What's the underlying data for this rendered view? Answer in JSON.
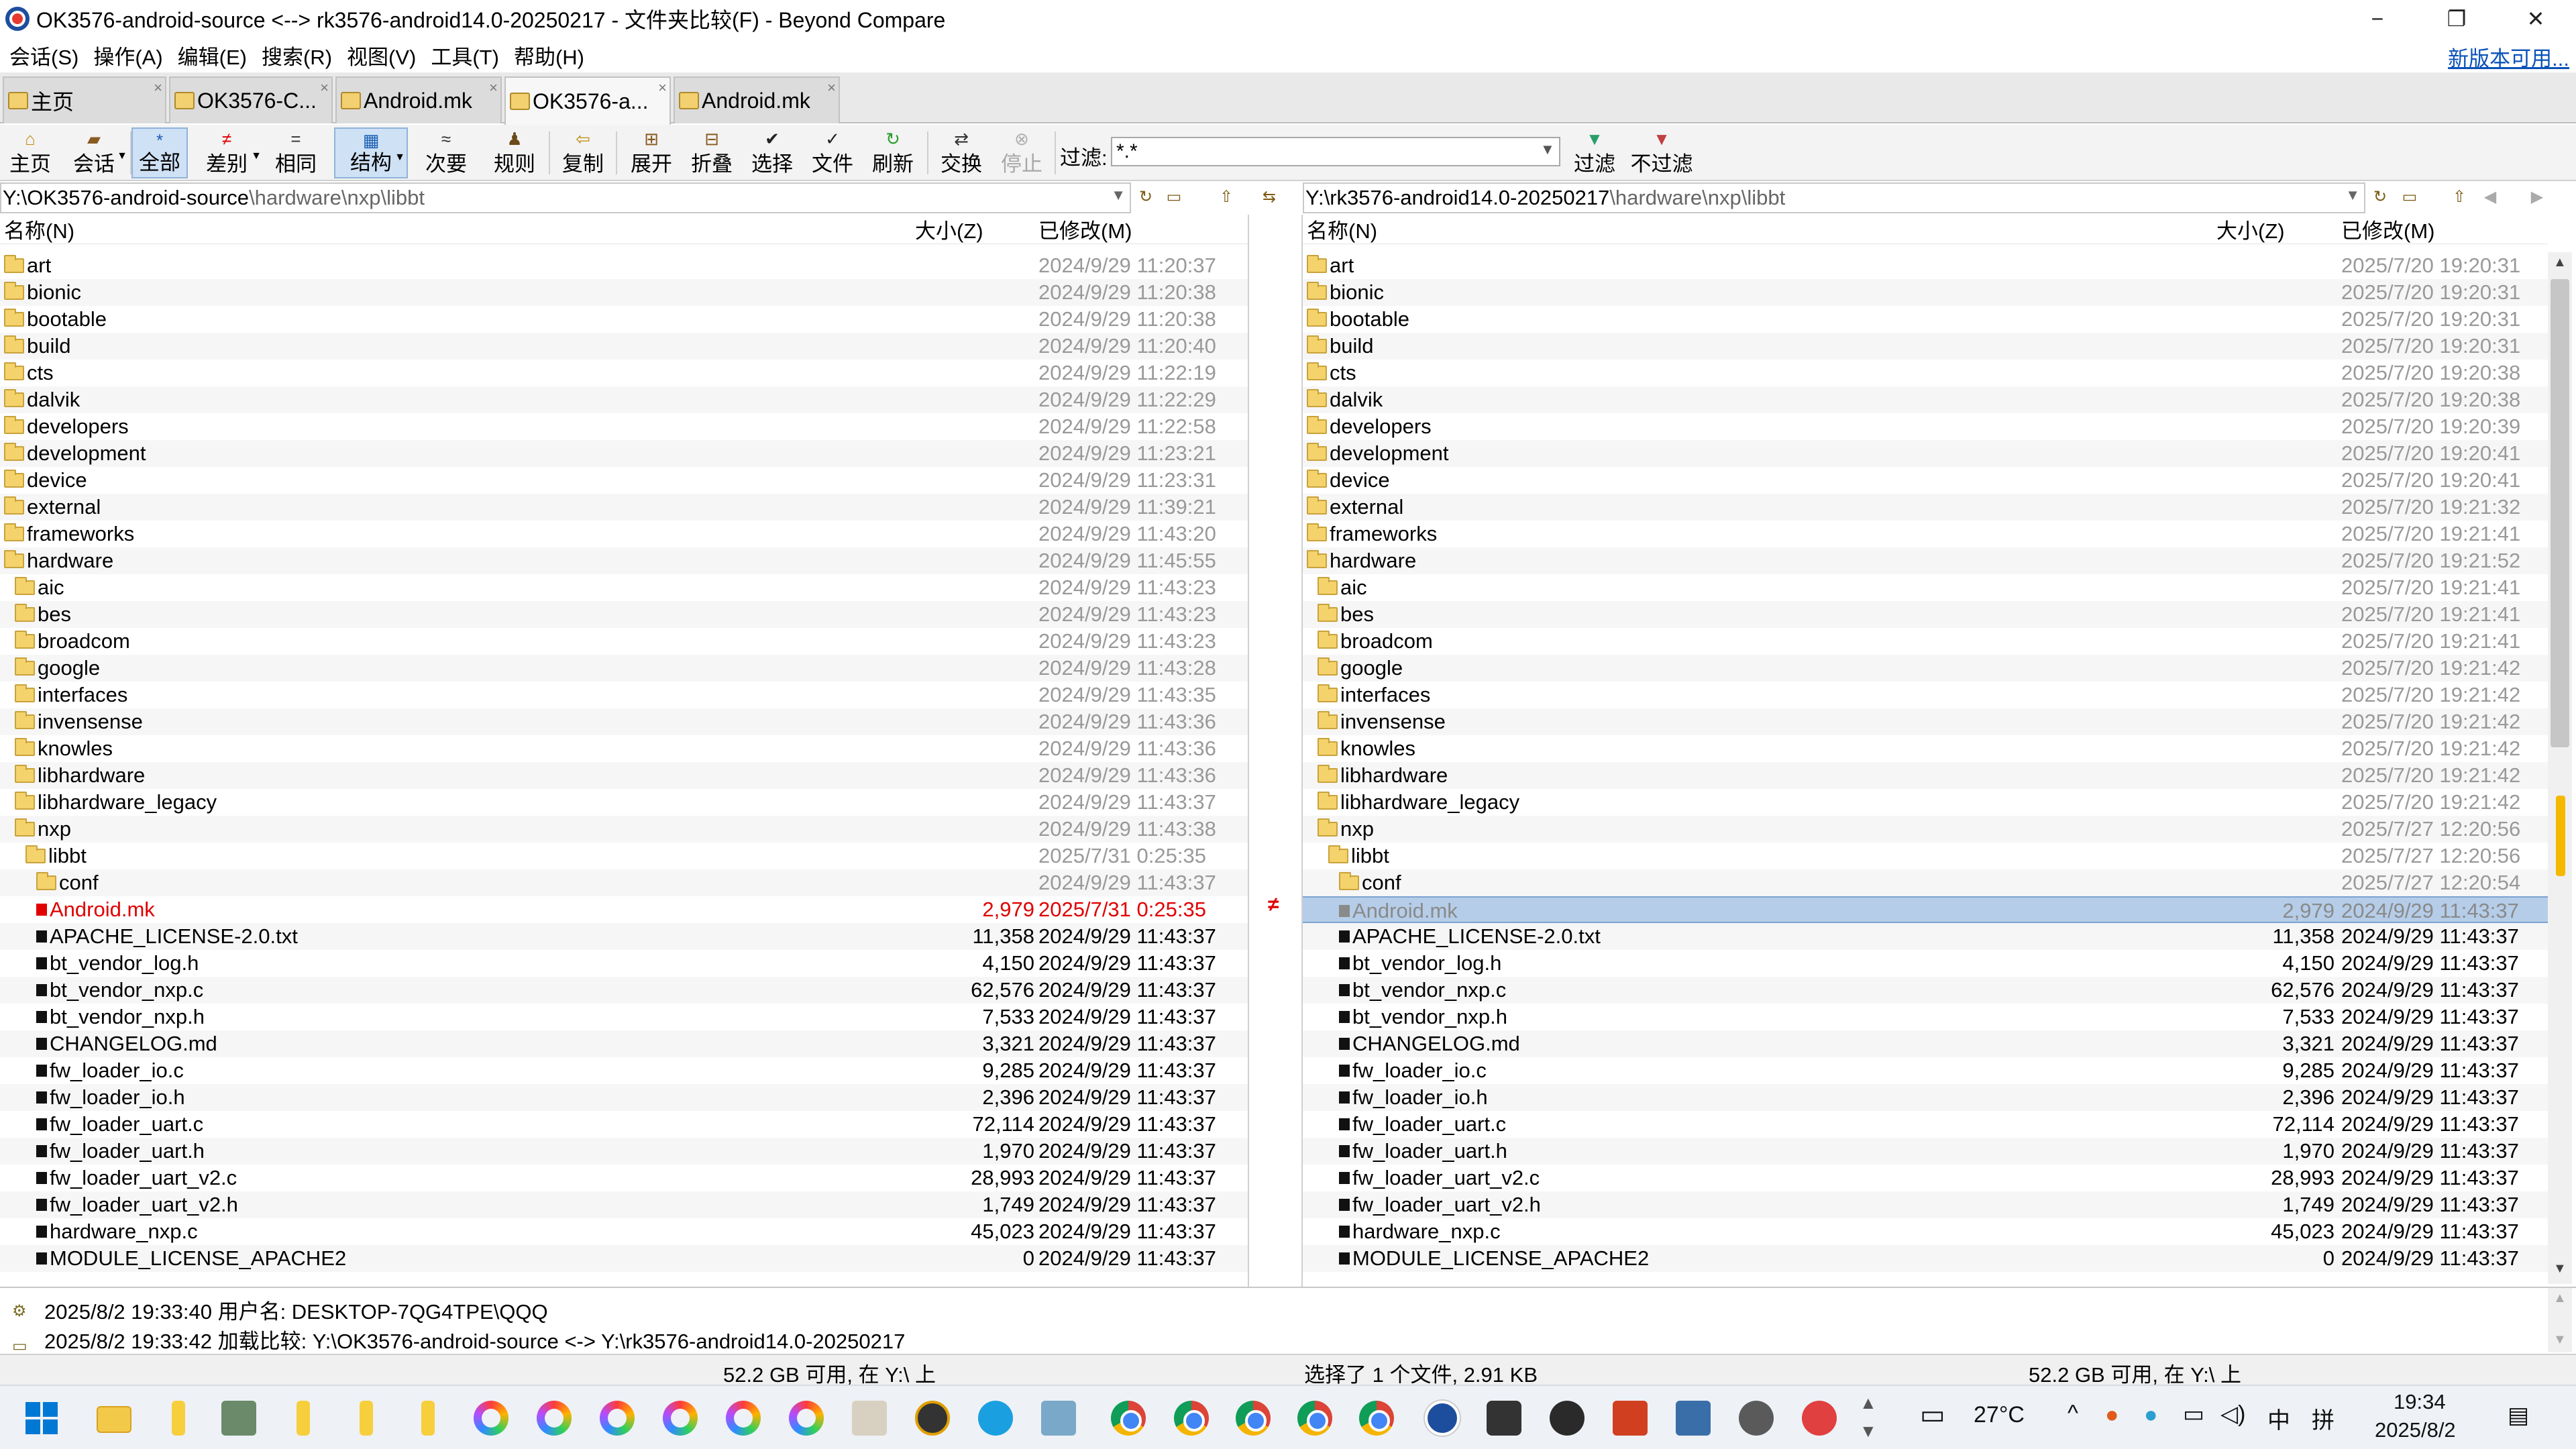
{
  "window": {
    "title": "OK3576-android-source <--> rk3576-android14.0-20250217 - 文件夹比较(F) - Beyond Compare",
    "minimize": "−",
    "maximize": "❐",
    "close": "✕"
  },
  "menu": [
    "会话(S)",
    "操作(A)",
    "编辑(E)",
    "搜索(R)",
    "视图(V)",
    "工具(T)",
    "帮助(H)"
  ],
  "update_link": "新版本可用...",
  "tabs": [
    "主页",
    "OK3576-C...",
    "Android.mk",
    "OK3576-a...",
    "Android.mk"
  ],
  "toolbar": {
    "home": "主页",
    "session": "会话",
    "all": "全部",
    "diff": "差别",
    "same": "相同",
    "structure": "结构",
    "minor": "次要",
    "rules": "规则",
    "copy": "复制",
    "expand": "展开",
    "collapse": "折叠",
    "select": "选择",
    "files": "文件",
    "refresh": "刷新",
    "swap": "交换",
    "stop": "停止",
    "filter_label": "过滤:",
    "filter_value": "*.*",
    "filter": "过滤",
    "no_filter": "不过滤"
  },
  "left": {
    "path_prefix": "Y:\\OK3576-android-source",
    "path_rest": "\\hardware\\nxp\\libbt",
    "col_name": "名称(N)",
    "col_size": "大小(Z)",
    "col_modified": "已修改(M)"
  },
  "right": {
    "path_prefix": "Y:\\rk3576-android14.0-20250217",
    "path_rest": "\\hardware\\nxp\\libbt",
    "col_name": "名称(N)",
    "col_size": "大小(Z)",
    "col_modified": "已修改(M)"
  },
  "center_mark": "≠",
  "left_rows": [
    {
      "name": "art",
      "type": "folder",
      "indent": 0,
      "size": "",
      "date": "2024/9/29 11:20:37"
    },
    {
      "name": "bionic",
      "type": "folder",
      "indent": 0,
      "size": "",
      "date": "2024/9/29 11:20:38"
    },
    {
      "name": "bootable",
      "type": "folder",
      "indent": 0,
      "size": "",
      "date": "2024/9/29 11:20:38"
    },
    {
      "name": "build",
      "type": "folder",
      "indent": 0,
      "size": "",
      "date": "2024/9/29 11:20:40"
    },
    {
      "name": "cts",
      "type": "folder",
      "indent": 0,
      "size": "",
      "date": "2024/9/29 11:22:19"
    },
    {
      "name": "dalvik",
      "type": "folder",
      "indent": 0,
      "size": "",
      "date": "2024/9/29 11:22:29"
    },
    {
      "name": "developers",
      "type": "folder",
      "indent": 0,
      "size": "",
      "date": "2024/9/29 11:22:58"
    },
    {
      "name": "development",
      "type": "folder",
      "indent": 0,
      "size": "",
      "date": "2024/9/29 11:23:21"
    },
    {
      "name": "device",
      "type": "folder",
      "indent": 0,
      "size": "",
      "date": "2024/9/29 11:23:31"
    },
    {
      "name": "external",
      "type": "folder",
      "indent": 0,
      "size": "",
      "date": "2024/9/29 11:39:21"
    },
    {
      "name": "frameworks",
      "type": "folder",
      "indent": 0,
      "size": "",
      "date": "2024/9/29 11:43:20"
    },
    {
      "name": "hardware",
      "type": "folder",
      "indent": 0,
      "size": "",
      "date": "2024/9/29 11:45:55"
    },
    {
      "name": "aic",
      "type": "folder",
      "indent": 1,
      "size": "",
      "date": "2024/9/29 11:43:23"
    },
    {
      "name": "bes",
      "type": "folder",
      "indent": 1,
      "size": "",
      "date": "2024/9/29 11:43:23"
    },
    {
      "name": "broadcom",
      "type": "folder",
      "indent": 1,
      "size": "",
      "date": "2024/9/29 11:43:23"
    },
    {
      "name": "google",
      "type": "folder",
      "indent": 1,
      "size": "",
      "date": "2024/9/29 11:43:28"
    },
    {
      "name": "interfaces",
      "type": "folder",
      "indent": 1,
      "size": "",
      "date": "2024/9/29 11:43:35"
    },
    {
      "name": "invensense",
      "type": "folder",
      "indent": 1,
      "size": "",
      "date": "2024/9/29 11:43:36"
    },
    {
      "name": "knowles",
      "type": "folder",
      "indent": 1,
      "size": "",
      "date": "2024/9/29 11:43:36"
    },
    {
      "name": "libhardware",
      "type": "folder",
      "indent": 1,
      "size": "",
      "date": "2024/9/29 11:43:36"
    },
    {
      "name": "libhardware_legacy",
      "type": "folder",
      "indent": 1,
      "size": "",
      "date": "2024/9/29 11:43:37"
    },
    {
      "name": "nxp",
      "type": "folder",
      "indent": 1,
      "size": "",
      "date": "2024/9/29 11:43:38"
    },
    {
      "name": "libbt",
      "type": "folder",
      "indent": 2,
      "size": "",
      "date": "2025/7/31 0:25:35"
    },
    {
      "name": "conf",
      "type": "folder",
      "indent": 3,
      "size": "",
      "date": "2024/9/29 11:43:37"
    },
    {
      "name": "Android.mk",
      "type": "file",
      "indent": 3,
      "size": "2,979",
      "date": "2025/7/31 0:25:35",
      "state": "diff"
    },
    {
      "name": "APACHE_LICENSE-2.0.txt",
      "type": "file",
      "indent": 3,
      "size": "11,358",
      "date": "2024/9/29 11:43:37"
    },
    {
      "name": "bt_vendor_log.h",
      "type": "file",
      "indent": 3,
      "size": "4,150",
      "date": "2024/9/29 11:43:37"
    },
    {
      "name": "bt_vendor_nxp.c",
      "type": "file",
      "indent": 3,
      "size": "62,576",
      "date": "2024/9/29 11:43:37"
    },
    {
      "name": "bt_vendor_nxp.h",
      "type": "file",
      "indent": 3,
      "size": "7,533",
      "date": "2024/9/29 11:43:37"
    },
    {
      "name": "CHANGELOG.md",
      "type": "file",
      "indent": 3,
      "size": "3,321",
      "date": "2024/9/29 11:43:37"
    },
    {
      "name": "fw_loader_io.c",
      "type": "file",
      "indent": 3,
      "size": "9,285",
      "date": "2024/9/29 11:43:37"
    },
    {
      "name": "fw_loader_io.h",
      "type": "file",
      "indent": 3,
      "size": "2,396",
      "date": "2024/9/29 11:43:37"
    },
    {
      "name": "fw_loader_uart.c",
      "type": "file",
      "indent": 3,
      "size": "72,114",
      "date": "2024/9/29 11:43:37"
    },
    {
      "name": "fw_loader_uart.h",
      "type": "file",
      "indent": 3,
      "size": "1,970",
      "date": "2024/9/29 11:43:37"
    },
    {
      "name": "fw_loader_uart_v2.c",
      "type": "file",
      "indent": 3,
      "size": "28,993",
      "date": "2024/9/29 11:43:37"
    },
    {
      "name": "fw_loader_uart_v2.h",
      "type": "file",
      "indent": 3,
      "size": "1,749",
      "date": "2024/9/29 11:43:37"
    },
    {
      "name": "hardware_nxp.c",
      "type": "file",
      "indent": 3,
      "size": "45,023",
      "date": "2024/9/29 11:43:37"
    },
    {
      "name": "MODULE_LICENSE_APACHE2",
      "type": "file",
      "indent": 3,
      "size": "0",
      "date": "2024/9/29 11:43:37"
    }
  ],
  "right_rows": [
    {
      "name": "art",
      "type": "folder",
      "indent": 0,
      "size": "",
      "date": "2025/7/20 19:20:31"
    },
    {
      "name": "bionic",
      "type": "folder",
      "indent": 0,
      "size": "",
      "date": "2025/7/20 19:20:31"
    },
    {
      "name": "bootable",
      "type": "folder",
      "indent": 0,
      "size": "",
      "date": "2025/7/20 19:20:31"
    },
    {
      "name": "build",
      "type": "folder",
      "indent": 0,
      "size": "",
      "date": "2025/7/20 19:20:31"
    },
    {
      "name": "cts",
      "type": "folder",
      "indent": 0,
      "size": "",
      "date": "2025/7/20 19:20:38"
    },
    {
      "name": "dalvik",
      "type": "folder",
      "indent": 0,
      "size": "",
      "date": "2025/7/20 19:20:38"
    },
    {
      "name": "developers",
      "type": "folder",
      "indent": 0,
      "size": "",
      "date": "2025/7/20 19:20:39"
    },
    {
      "name": "development",
      "type": "folder",
      "indent": 0,
      "size": "",
      "date": "2025/7/20 19:20:41"
    },
    {
      "name": "device",
      "type": "folder",
      "indent": 0,
      "size": "",
      "date": "2025/7/20 19:20:41"
    },
    {
      "name": "external",
      "type": "folder",
      "indent": 0,
      "size": "",
      "date": "2025/7/20 19:21:32"
    },
    {
      "name": "frameworks",
      "type": "folder",
      "indent": 0,
      "size": "",
      "date": "2025/7/20 19:21:41"
    },
    {
      "name": "hardware",
      "type": "folder",
      "indent": 0,
      "size": "",
      "date": "2025/7/20 19:21:52"
    },
    {
      "name": "aic",
      "type": "folder",
      "indent": 1,
      "size": "",
      "date": "2025/7/20 19:21:41"
    },
    {
      "name": "bes",
      "type": "folder",
      "indent": 1,
      "size": "",
      "date": "2025/7/20 19:21:41"
    },
    {
      "name": "broadcom",
      "type": "folder",
      "indent": 1,
      "size": "",
      "date": "2025/7/20 19:21:41"
    },
    {
      "name": "google",
      "type": "folder",
      "indent": 1,
      "size": "",
      "date": "2025/7/20 19:21:42"
    },
    {
      "name": "interfaces",
      "type": "folder",
      "indent": 1,
      "size": "",
      "date": "2025/7/20 19:21:42"
    },
    {
      "name": "invensense",
      "type": "folder",
      "indent": 1,
      "size": "",
      "date": "2025/7/20 19:21:42"
    },
    {
      "name": "knowles",
      "type": "folder",
      "indent": 1,
      "size": "",
      "date": "2025/7/20 19:21:42"
    },
    {
      "name": "libhardware",
      "type": "folder",
      "indent": 1,
      "size": "",
      "date": "2025/7/20 19:21:42"
    },
    {
      "name": "libhardware_legacy",
      "type": "folder",
      "indent": 1,
      "size": "",
      "date": "2025/7/20 19:21:42"
    },
    {
      "name": "nxp",
      "type": "folder",
      "indent": 1,
      "size": "",
      "date": "2025/7/27 12:20:56"
    },
    {
      "name": "libbt",
      "type": "folder",
      "indent": 2,
      "size": "",
      "date": "2025/7/27 12:20:56"
    },
    {
      "name": "conf",
      "type": "folder",
      "indent": 3,
      "size": "",
      "date": "2025/7/27 12:20:54"
    },
    {
      "name": "Android.mk",
      "type": "file",
      "indent": 3,
      "size": "2,979",
      "date": "2024/9/29 11:43:37",
      "state": "sel"
    },
    {
      "name": "APACHE_LICENSE-2.0.txt",
      "type": "file",
      "indent": 3,
      "size": "11,358",
      "date": "2024/9/29 11:43:37"
    },
    {
      "name": "bt_vendor_log.h",
      "type": "file",
      "indent": 3,
      "size": "4,150",
      "date": "2024/9/29 11:43:37"
    },
    {
      "name": "bt_vendor_nxp.c",
      "type": "file",
      "indent": 3,
      "size": "62,576",
      "date": "2024/9/29 11:43:37"
    },
    {
      "name": "bt_vendor_nxp.h",
      "type": "file",
      "indent": 3,
      "size": "7,533",
      "date": "2024/9/29 11:43:37"
    },
    {
      "name": "CHANGELOG.md",
      "type": "file",
      "indent": 3,
      "size": "3,321",
      "date": "2024/9/29 11:43:37"
    },
    {
      "name": "fw_loader_io.c",
      "type": "file",
      "indent": 3,
      "size": "9,285",
      "date": "2024/9/29 11:43:37"
    },
    {
      "name": "fw_loader_io.h",
      "type": "file",
      "indent": 3,
      "size": "2,396",
      "date": "2024/9/29 11:43:37"
    },
    {
      "name": "fw_loader_uart.c",
      "type": "file",
      "indent": 3,
      "size": "72,114",
      "date": "2024/9/29 11:43:37"
    },
    {
      "name": "fw_loader_uart.h",
      "type": "file",
      "indent": 3,
      "size": "1,970",
      "date": "2024/9/29 11:43:37"
    },
    {
      "name": "fw_loader_uart_v2.c",
      "type": "file",
      "indent": 3,
      "size": "28,993",
      "date": "2024/9/29 11:43:37"
    },
    {
      "name": "fw_loader_uart_v2.h",
      "type": "file",
      "indent": 3,
      "size": "1,749",
      "date": "2024/9/29 11:43:37"
    },
    {
      "name": "hardware_nxp.c",
      "type": "file",
      "indent": 3,
      "size": "45,023",
      "date": "2024/9/29 11:43:37"
    },
    {
      "name": "MODULE_LICENSE_APACHE2",
      "type": "file",
      "indent": 3,
      "size": "0",
      "date": "2024/9/29 11:43:37"
    }
  ],
  "log": [
    "2025/8/2 19:33:40  用户名: DESKTOP-7QG4TPE\\QQQ",
    "2025/8/2 19:33:42  加载比较: Y:\\OK3576-android-source <-> Y:\\rk3576-android14.0-20250217"
  ],
  "status": {
    "left_free": "52.2 GB 可用, 在 Y:\\ 上",
    "selection": "选择了 1 个文件, 2.91 KB",
    "right_free": "52.2 GB 可用, 在 Y:\\ 上"
  },
  "taskbar": {
    "weather": "27°C",
    "ime1": "中",
    "ime2": "拼",
    "time": "19:34",
    "date": "2025/8/2"
  },
  "colors": {
    "diff": "#e00000",
    "selection": "#b5cde8",
    "pressed": "#cfe1f5"
  }
}
